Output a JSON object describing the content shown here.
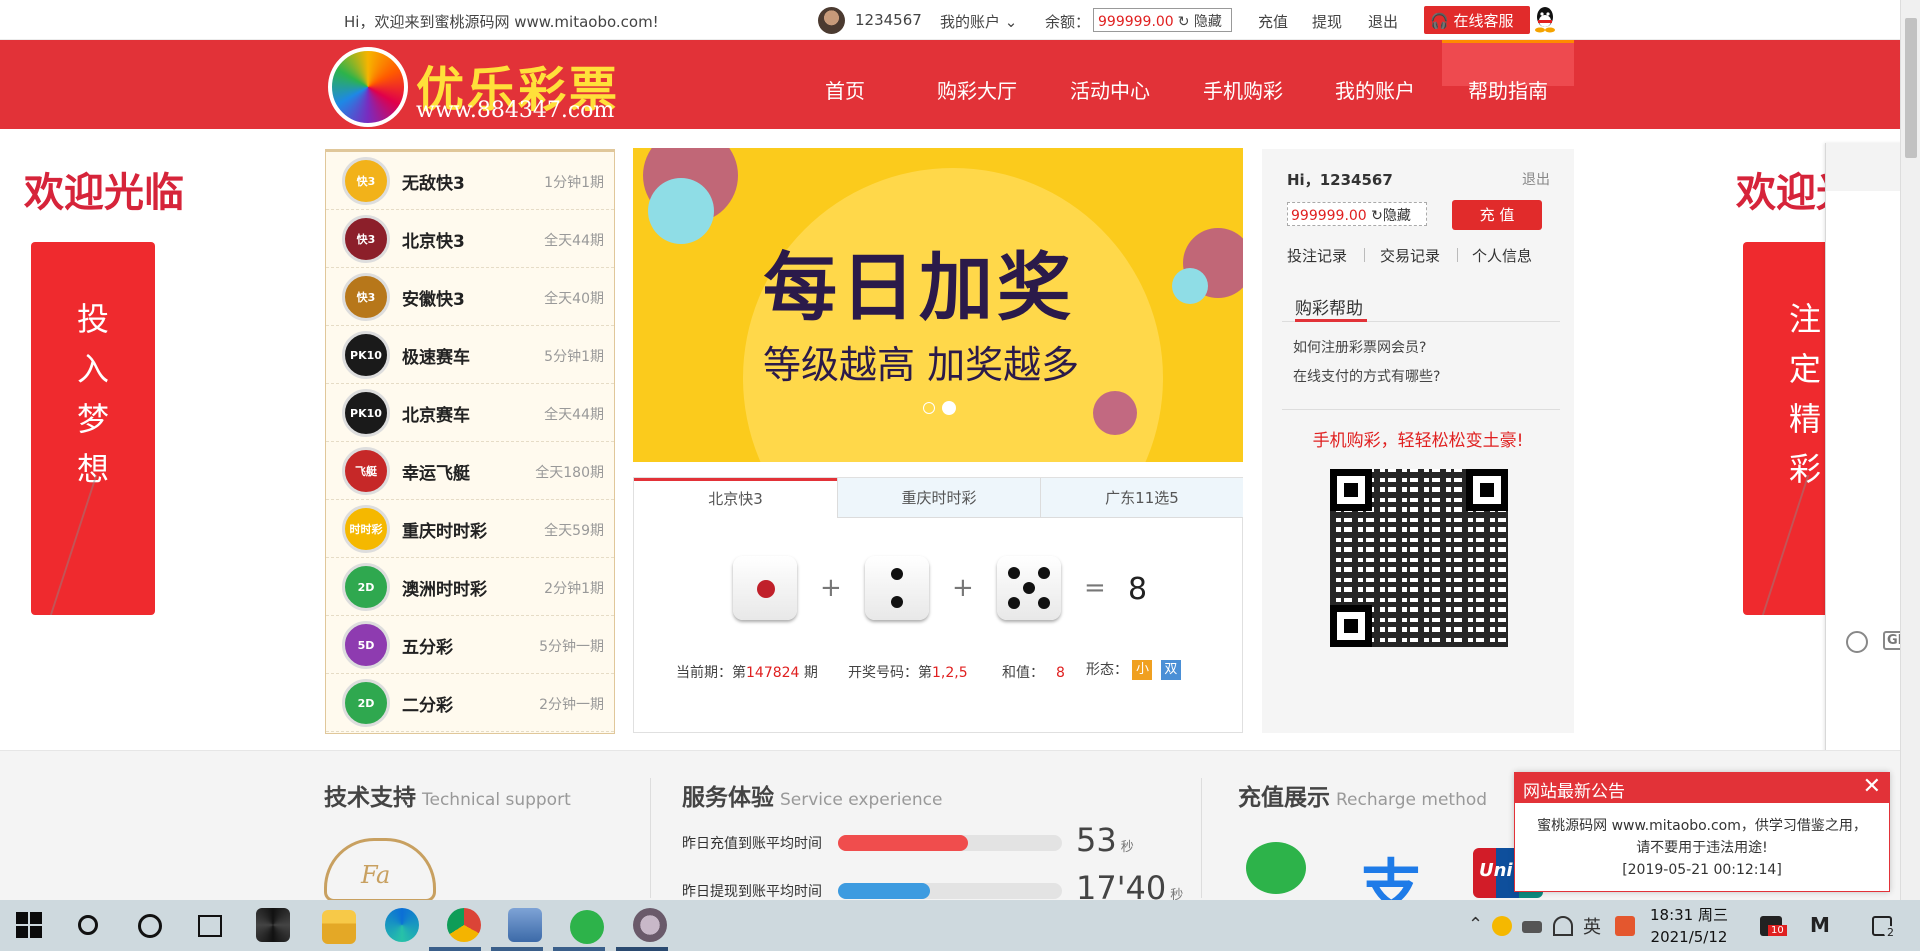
{
  "topbar": {
    "welcome": "Hi，欢迎来到蜜桃源码网 www.mitaobo.com!",
    "username": "1234567",
    "account_menu": "我的账户",
    "balance_label": "余额：",
    "balance": "999999.00",
    "hide_label": "隐藏",
    "recharge": "充值",
    "withdraw": "提现",
    "logout": "退出",
    "service": "在线客服"
  },
  "header": {
    "logo_text": "优乐彩票",
    "logo_url": "www.884347.com",
    "nav": [
      "首页",
      "购彩大厅",
      "活动中心",
      "手机购彩",
      "我的账户",
      "帮助指南"
    ]
  },
  "side": {
    "welcome_left": "欢迎光临",
    "welcome_right": "欢迎光",
    "left_banner": [
      "投",
      "入",
      "梦",
      "想"
    ],
    "right_banner": [
      "注",
      "定",
      "精",
      "彩"
    ]
  },
  "lotteries": [
    {
      "name": "无敌快3",
      "freq": "1分钟1期",
      "icon_text": "快3",
      "color": "#f2b21a"
    },
    {
      "name": "北京快3",
      "freq": "全天44期",
      "icon_text": "快3",
      "color": "#8c1f2a"
    },
    {
      "name": "安徽快3",
      "freq": "全天40期",
      "icon_text": "快3",
      "color": "#b7771a"
    },
    {
      "name": "极速赛车",
      "freq": "5分钟1期",
      "icon_text": "PK10",
      "color": "#1a1a1a"
    },
    {
      "name": "北京赛车",
      "freq": "全天44期",
      "icon_text": "PK10",
      "color": "#1a1a1a"
    },
    {
      "name": "幸运飞艇",
      "freq": "全天180期",
      "icon_text": "飞艇",
      "color": "#c62828"
    },
    {
      "name": "重庆时时彩",
      "freq": "全天59期",
      "icon_text": "时时彩",
      "color": "#f5b800"
    },
    {
      "name": "澳洲时时彩",
      "freq": "2分钟1期",
      "icon_text": "2D",
      "color": "#2fa84f"
    },
    {
      "name": "五分彩",
      "freq": "5分钟一期",
      "icon_text": "5D",
      "color": "#8e3bb0"
    },
    {
      "name": "二分彩",
      "freq": "2分钟一期",
      "icon_text": "2D",
      "color": "#2fa84f"
    }
  ],
  "banner": {
    "title": "每日加奖",
    "subtitle": "等级越高 加奖越多"
  },
  "draw": {
    "tabs": [
      "北京快3",
      "重庆时时彩",
      "广东11选5"
    ],
    "plus": "+",
    "equals": "=",
    "sum": "8",
    "current_label": "当前期：第",
    "current_issue": "147824",
    "issue_suffix": "期",
    "numbers_label": "开奖号码：第",
    "numbers": "1,2,5",
    "sum_label": "和值：",
    "sum_value": "8",
    "shape_label": "形态：",
    "shape_small": "小",
    "shape_even": "双"
  },
  "account": {
    "hi": "Hi，1234567",
    "logout": "退出",
    "balance": "999999.00",
    "hide_label": "隐藏",
    "recharge": "充 值",
    "links": [
      "投注记录",
      "交易记录",
      "个人信息"
    ],
    "help_title": "购彩帮助",
    "help_items": [
      "如何注册彩票网会员?",
      "在线支付的方式有哪些?"
    ],
    "mobile_slogan": "手机购彩，轻轻松松变土豪!"
  },
  "chat": {
    "gif": "GIF"
  },
  "footer": {
    "tech_title": "技术支持",
    "tech_title_en": "Technical support",
    "service_title": "服务体验",
    "service_title_en": "Service experience",
    "recharge_title": "充值展示",
    "recharge_title_en": "Recharge method",
    "logo_mark": "Fa",
    "stats": [
      {
        "label": "昨日充值到账平均时间",
        "value": "53",
        "unit": "秒",
        "fill": 0.58,
        "color": "#f04d4d"
      },
      {
        "label": "昨日提现到账平均时间",
        "value": "17'40",
        "unit": "秒",
        "fill": 0.41,
        "color": "#3d9be0"
      }
    ],
    "alipay_glyph": "支",
    "union_text": "Uni"
  },
  "notice": {
    "title": "网站最新公告",
    "line1": "蜜桃源码网 www.mitaobo.com，供学习借鉴之用，",
    "line2": "请不要用于违法用途!",
    "line3": "[2019-05-21 00:12:14]"
  },
  "taskbar": {
    "time": "18:31 周三",
    "date": "2021/5/12",
    "notif_badge": "10",
    "action_badge": "2",
    "ime": "英"
  }
}
